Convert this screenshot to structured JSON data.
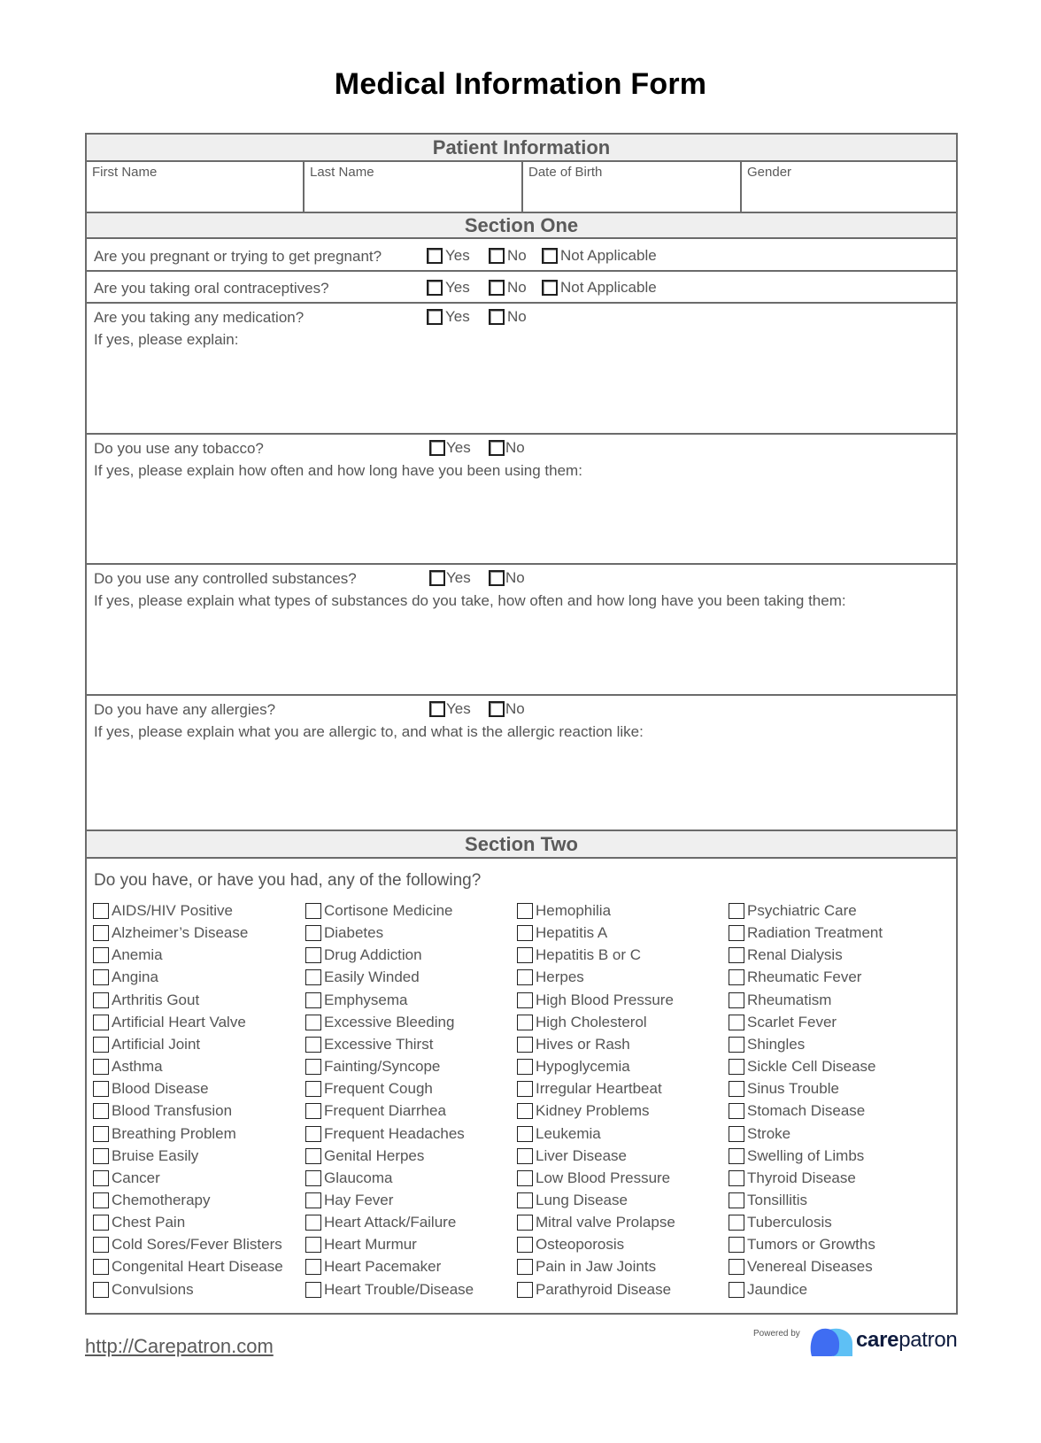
{
  "title": "Medical Information Form",
  "patient_information": {
    "heading": "Patient Information",
    "fields": [
      {
        "label": "First Name",
        "value": ""
      },
      {
        "label": "Last Name",
        "value": ""
      },
      {
        "label": "Date of Birth",
        "value": ""
      },
      {
        "label": "Gender",
        "value": ""
      }
    ]
  },
  "section_one": {
    "heading": "Section One",
    "questions": [
      {
        "question": "Are you pregnant or trying to get pregnant?",
        "options": [
          "Yes",
          "No",
          "Not Applicable"
        ],
        "followup": ""
      },
      {
        "question": "Are you taking oral contraceptives?",
        "options": [
          "Yes",
          "No",
          "Not Applicable"
        ],
        "followup": ""
      },
      {
        "question": "Are you taking any medication?",
        "options": [
          "Yes",
          "No"
        ],
        "followup": "If yes, please explain:"
      },
      {
        "question": "Do you use any tobacco?",
        "options": [
          "Yes",
          "No"
        ],
        "followup": "If yes, please explain how often and how long have you been using them:"
      },
      {
        "question": "Do you use any controlled substances?",
        "options": [
          "Yes",
          "No"
        ],
        "followup": "If yes, please explain what types of substances do you take, how often and how long have you been taking them:"
      },
      {
        "question": "Do you have any allergies?",
        "options": [
          "Yes",
          "No"
        ],
        "followup": "If yes, please explain what you are allergic to, and what is the allergic reaction like:"
      }
    ]
  },
  "section_two": {
    "heading": "Section Two",
    "prompt": "Do you have, or have you had, any of the following?",
    "columns": [
      [
        "AIDS/HIV Positive",
        "Alzheimer’s Disease",
        "Anemia",
        "Angina",
        "Arthritis Gout",
        "Artificial Heart Valve",
        "Artificial Joint",
        "Asthma",
        "Blood Disease",
        "Blood Transfusion",
        "Breathing Problem",
        "Bruise Easily",
        "Cancer",
        "Chemotherapy",
        "Chest Pain",
        "Cold Sores/Fever Blisters",
        "Congenital Heart Disease",
        "Convulsions"
      ],
      [
        "Cortisone Medicine",
        "Diabetes",
        "Drug Addiction",
        "Easily Winded",
        "Emphysema",
        "Excessive Bleeding",
        "Excessive Thirst",
        "Fainting/Syncope",
        "Frequent Cough",
        "Frequent Diarrhea",
        "Frequent Headaches",
        "Genital Herpes",
        "Glaucoma",
        "Hay Fever",
        "Heart Attack/Failure",
        "Heart Murmur",
        "Heart Pacemaker",
        "Heart Trouble/Disease"
      ],
      [
        "Hemophilia",
        "Hepatitis A",
        "Hepatitis B or C",
        "Herpes",
        "High Blood Pressure",
        "High Cholesterol",
        "Hives or Rash",
        "Hypoglycemia",
        "Irregular Heartbeat",
        "Kidney Problems",
        "Leukemia",
        "Liver Disease",
        "Low Blood Pressure",
        "Lung Disease",
        "Mitral valve Prolapse",
        "Osteoporosis",
        "Pain in Jaw Joints",
        "Parathyroid Disease"
      ],
      [
        "Psychiatric Care",
        "Radiation Treatment",
        "Renal Dialysis",
        "Rheumatic Fever",
        "Rheumatism",
        "Scarlet Fever",
        "Shingles",
        "Sickle Cell Disease",
        "Sinus Trouble",
        "Stomach Disease",
        "Stroke",
        "Swelling of Limbs",
        "Thyroid Disease",
        "Tonsillitis",
        "Tuberculosis",
        "Tumors or Growths",
        "Venereal Diseases",
        "Jaundice"
      ]
    ]
  },
  "footer": {
    "link": "http://Carepatron.com",
    "powered_by": "Powered by",
    "brand_bold": "care",
    "brand_regular": "patron",
    "brand_colors": {
      "blob_dark": "#3f6df2",
      "blob_light": "#5ec0f5",
      "text": "#0f1c3f"
    }
  }
}
